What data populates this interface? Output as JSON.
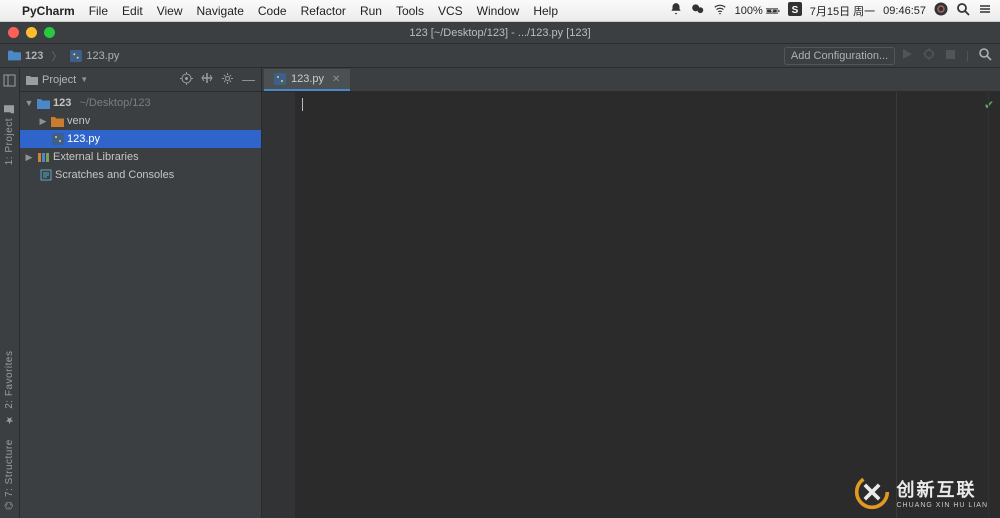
{
  "menubar": {
    "app": "PyCharm",
    "items": [
      "File",
      "Edit",
      "View",
      "Navigate",
      "Code",
      "Refactor",
      "Run",
      "Tools",
      "VCS",
      "Window",
      "Help"
    ],
    "right": {
      "battery": "100%",
      "date": "7月15日 周一",
      "time": "09:46:57"
    }
  },
  "window": {
    "title": "123 [~/Desktop/123] - .../123.py [123]"
  },
  "breadcrumb": {
    "project": "123",
    "file": "123.py"
  },
  "toolbar": {
    "addConfig": "Add Configuration..."
  },
  "sidebar": {
    "title": "Project",
    "left_labels": {
      "project": "1: Project",
      "favorites": "2: Favorites",
      "structure": "7: Structure"
    },
    "tree": {
      "root": {
        "name": "123",
        "path": "~/Desktop/123"
      },
      "venv": "venv",
      "file": "123.py",
      "ext": "External Libraries",
      "scratch": "Scratches and Consoles"
    }
  },
  "editor": {
    "tab": "123.py"
  },
  "watermark": {
    "big": "创新互联",
    "small": "CHUANG XIN HU LIAN"
  }
}
